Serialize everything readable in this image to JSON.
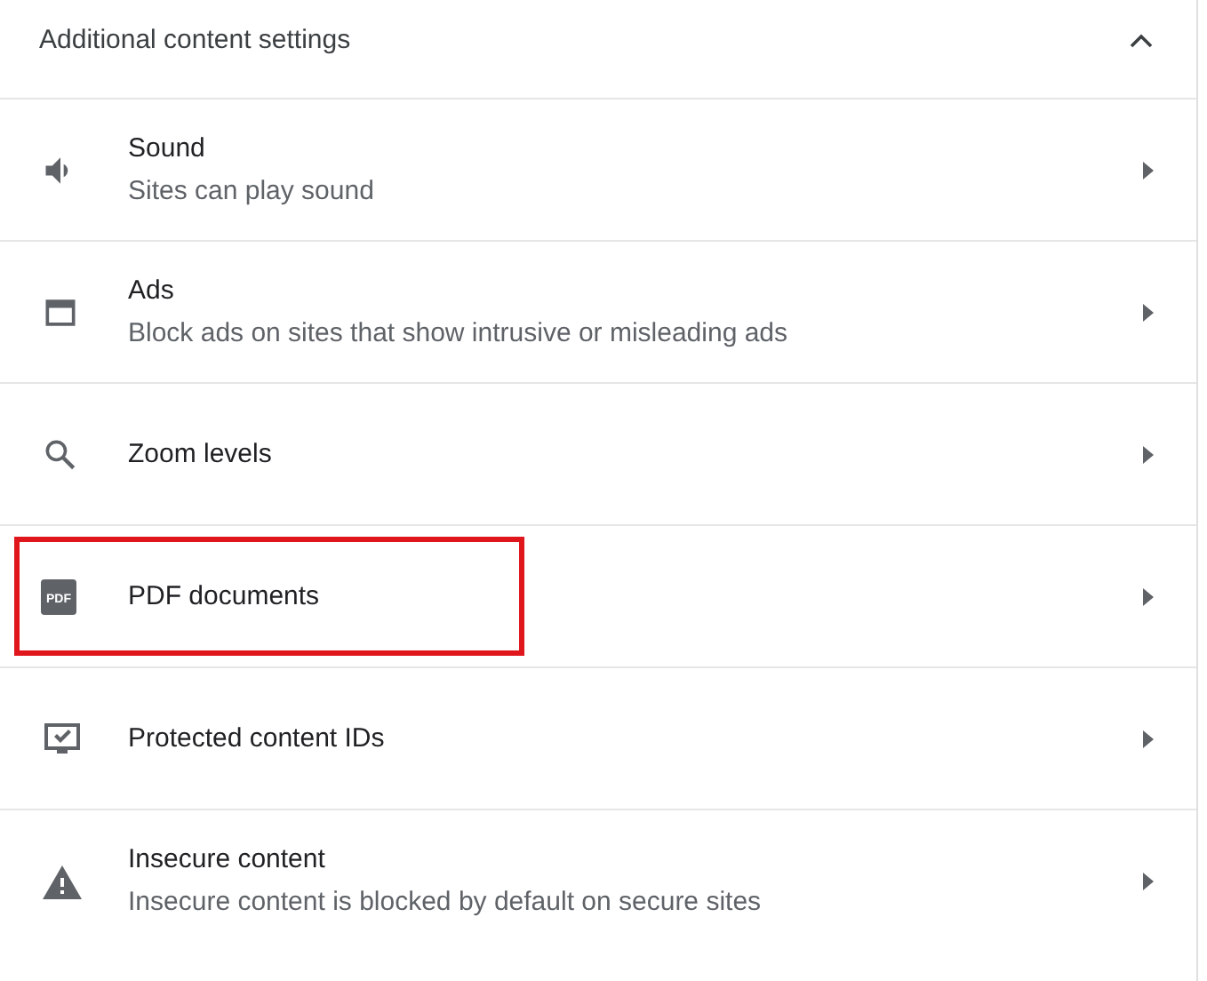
{
  "section": {
    "title": "Additional content settings",
    "expanded": true
  },
  "items": [
    {
      "title": "Sound",
      "subtitle": "Sites can play sound",
      "highlighted": false
    },
    {
      "title": "Ads",
      "subtitle": "Block ads on sites that show intrusive or misleading ads",
      "highlighted": false
    },
    {
      "title": "Zoom levels",
      "highlighted": false
    },
    {
      "title": "PDF documents",
      "icon_text": "PDF",
      "highlighted": true
    },
    {
      "title": "Protected content IDs",
      "highlighted": false
    },
    {
      "title": "Insecure content",
      "subtitle": "Insecure content is blocked by default on secure sites",
      "highlighted": false
    }
  ]
}
